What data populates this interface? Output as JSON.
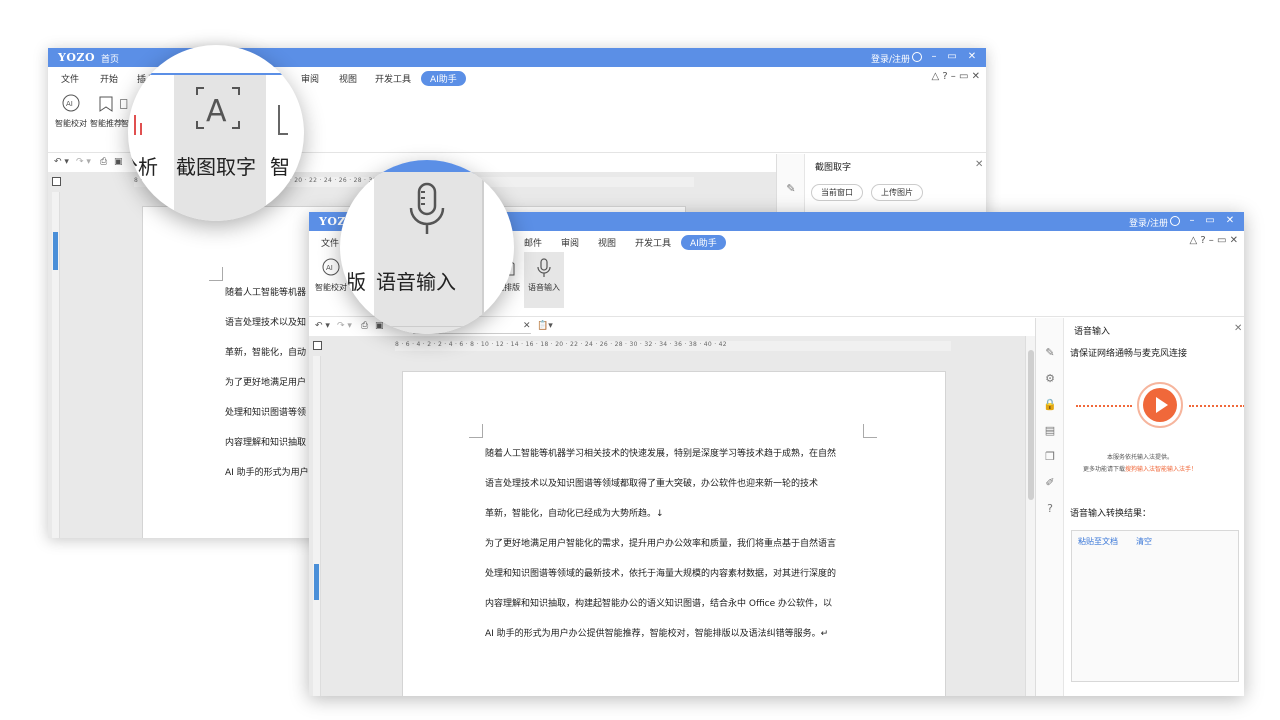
{
  "back_window": {
    "logo": "YOZO",
    "home_label": "首页",
    "login_label": "登录/注册",
    "menu": [
      "文件",
      "开始",
      "插入",
      "审阅",
      "视图",
      "开发工具",
      "AI助手"
    ],
    "ribbon_buttons": [
      "智能校对",
      "智能推荐",
      "智"
    ],
    "ruler_text": "8 · 6 · 4 · 2 · 2 · 4 · 6 · 8 · 10 · 12 · 14 · 16 · 18 · 20 · 22 · 24 · 26 · 28 · 30 · 32 · 34 · 36 · 38 · 40 · 42",
    "doc_lines": [
      "随着人工智能等机器",
      "语言处理技术以及知",
      "革新，智能化，自动",
      "为了更好地满足用户",
      "处理和知识图谱等领",
      "内容理解和知识抽取",
      "AI 助手的形式为用户"
    ],
    "side_panel": {
      "title": "截图取字",
      "btn_current": "当前窗口",
      "btn_upload": "上传图片"
    },
    "lens": {
      "left_text": "分析",
      "center_text": "截图取字",
      "right_text": "智"
    }
  },
  "front_window": {
    "logo": "YOZO",
    "login_label": "登录/注册",
    "menu": [
      "文件",
      "邮件",
      "审阅",
      "视图",
      "开发工具",
      "AI助手"
    ],
    "ribbon_buttons": [
      "智能校对",
      "能排版",
      "语音输入"
    ],
    "ruler_text": "8 · 6 · 4 · 2 · 2 · 4 · 6 · 8 · 10 · 12 · 14 · 16 · 18 · 20 · 22 · 24 · 26 · 28 · 30 · 32 · 34 · 36 · 38 · 40 · 42",
    "doc_lines": [
      "随着人工智能等机器学习相关技术的快速发展，特别是深度学习等技术趋于成熟，在自然",
      "语言处理技术以及知识图谱等领域都取得了重大突破，办公软件也迎来新一轮的技术",
      "革新，智能化，自动化已经成为大势所趋。↓",
      "为了更好地满足用户智能化的需求，提升用户办公效率和质量，我们将重点基于自然语言",
      "处理和知识图谱等领域的最新技术，依托于海量大规模的内容素材数据，对其进行深度的",
      "内容理解和知识抽取，构建起智能办公的语义知识图谱，结合永中 Office 办公软件，以",
      "AI 助手的形式为用户办公提供智能推荐，智能校对，智能排版以及语法纠错等服务。↵"
    ],
    "side_panel": {
      "title": "语音输入",
      "hint": "请保证网络通畅与麦克风连接",
      "note1": "本服务依托输入法提供。",
      "note2_prefix": "更多功能请下载",
      "note2_link": "搜狗输入法智能输入法手！",
      "result_label": "语音输入转换结果：",
      "paste_btn": "粘贴至文档",
      "clear_btn": "清空"
    },
    "lens": {
      "left_text": "版",
      "center_text": "语音输入"
    }
  },
  "colors": {
    "title_blue": "#5b8fe6",
    "play_orange": "#f0683a",
    "link_blue": "#3b78d8"
  }
}
